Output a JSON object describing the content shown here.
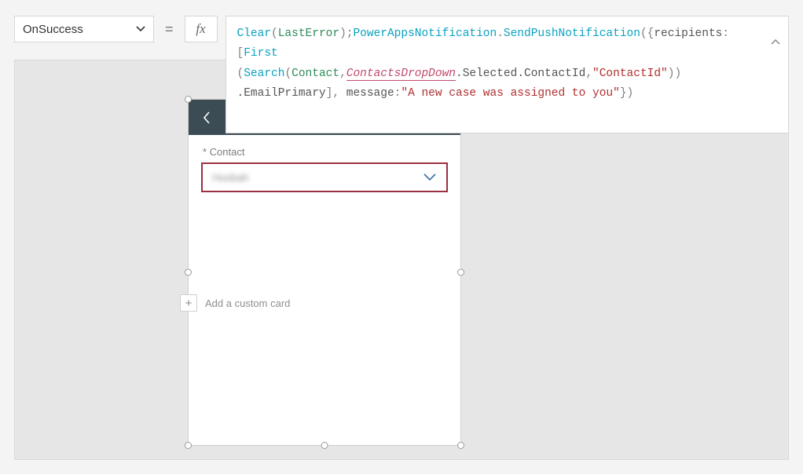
{
  "formulaBar": {
    "property": "OnSuccess",
    "equalsSymbol": "=",
    "fxLabel": "fx",
    "tokens": {
      "clear": "Clear",
      "lastError": "LastError",
      "ppn": "PowerAppsNotification",
      "sendPush": "SendPushNotification",
      "recipients": "recipients",
      "first": "First",
      "search": "Search",
      "contact": "Contact",
      "contactsDropDown": "ContactsDropDown",
      "selected": ".Selected.ContactId",
      "contactIdStr": "\"ContactId\"",
      "emailPrimary": ".EmailPrimary",
      "message": "message",
      "msgStr": "\"A new case was assigned to you\""
    }
  },
  "canvas": {
    "contactLabel": "* Contact",
    "dropdownBlur": "Hoobah",
    "addCustomCard": "Add a custom card"
  }
}
